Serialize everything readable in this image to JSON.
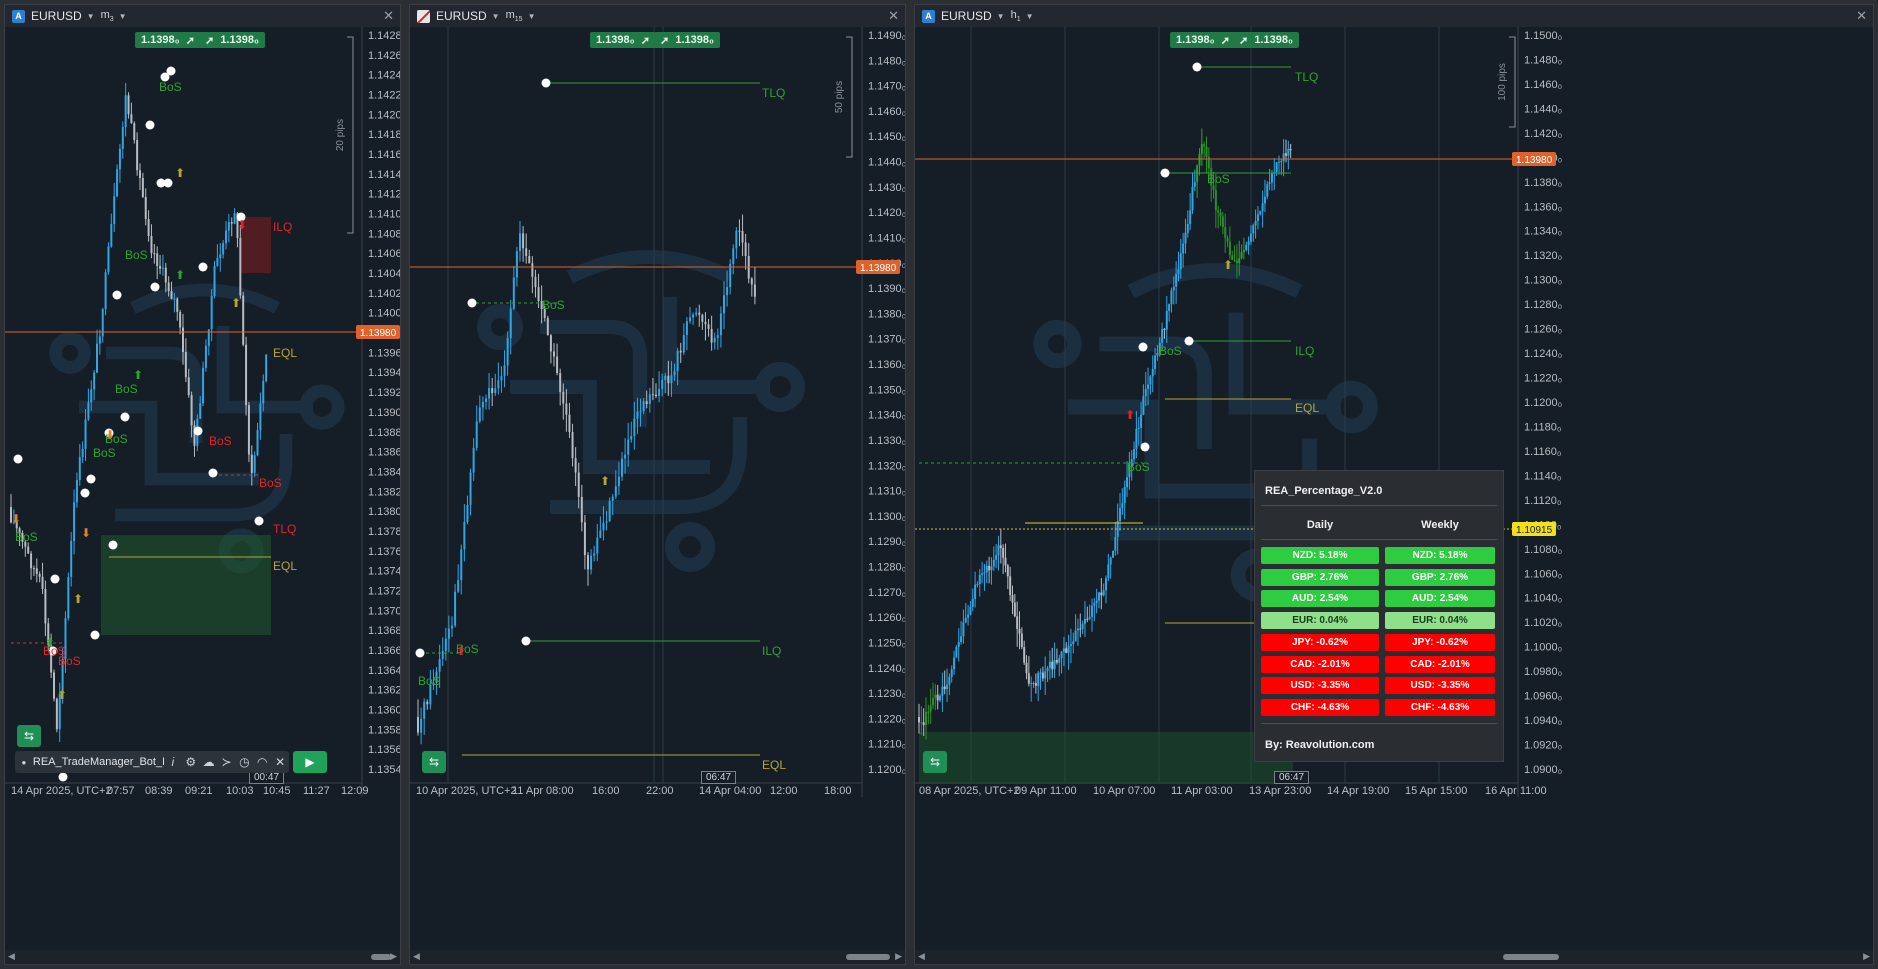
{
  "panes": [
    {
      "symbol": "EURUSD",
      "timeframe_main": "m",
      "timeframe_sub": "3",
      "bid_tag": "1.1398₀",
      "ask_tag": "1.1398₀",
      "y_labels": [
        "1.1428₀",
        "1.1426₀",
        "1.1424₀",
        "1.1422₀",
        "1.1420₀",
        "1.1418₀",
        "1.1416₀",
        "1.1414₀",
        "1.1412₀",
        "1.1410₀",
        "1.1408₀",
        "1.1406₀",
        "1.1404₀",
        "1.1402₀",
        "1.1400₀",
        "1.1398₀",
        "1.1396₀",
        "1.1394₀",
        "1.1392₀",
        "1.1390₀",
        "1.1388₀",
        "1.1386₀",
        "1.1384₀",
        "1.1382₀",
        "1.1380₀",
        "1.1378₀",
        "1.1376₀",
        "1.1374₀",
        "1.1372₀",
        "1.1370₀",
        "1.1368₀",
        "1.1366₀",
        "1.1364₀",
        "1.1362₀",
        "1.1360₀",
        "1.1358₀",
        "1.1356₀",
        "1.1354₀"
      ],
      "x_labels": [
        "14 Apr 2025, UTC+2",
        "07:57",
        "08:39",
        "09:21",
        "10:03",
        "10:45",
        "11:27",
        "12:09"
      ],
      "current_price": "1.13980",
      "pips_label": "20 pips",
      "time_box": "00:47",
      "annotations": [
        "BoS",
        "BoS",
        "BoS",
        "BoS",
        "BoS",
        "BoS",
        "BoS",
        "BoS",
        "BoS",
        "ILQ",
        "EQL",
        "TLQ",
        "EQL",
        "BoS"
      ],
      "bot_name": "REA_TradeManager_Bot_Lice..."
    },
    {
      "symbol": "EURUSD",
      "timeframe_main": "m",
      "timeframe_sub": "15",
      "bid_tag": "1.1398₀",
      "ask_tag": "1.1398₀",
      "y_labels": [
        "1.1490₀",
        "1.1480₀",
        "1.1470₀",
        "1.1460₀",
        "1.1450₀",
        "1.1440₀",
        "1.1430₀",
        "1.1420₀",
        "1.1410₀",
        "1.1400₀",
        "1.1390₀",
        "1.1380₀",
        "1.1370₀",
        "1.1360₀",
        "1.1350₀",
        "1.1340₀",
        "1.1330₀",
        "1.1320₀",
        "1.1310₀",
        "1.1300₀",
        "1.1290₀",
        "1.1280₀",
        "1.1270₀",
        "1.1260₀",
        "1.1250₀",
        "1.1240₀",
        "1.1230₀",
        "1.1220₀",
        "1.1210₀",
        "1.1200₀"
      ],
      "x_labels": [
        "10 Apr 2025, UTC+2",
        "11 Apr 08:00",
        "16:00",
        "22:00",
        "14 Apr 04:00",
        "12:00",
        "18:00"
      ],
      "current_price": "1.13980",
      "pips_label": "50 pips",
      "time_box": "06:47",
      "annotations": [
        "TLQ",
        "BoS",
        "BoS",
        "BoS",
        "ILQ",
        "EQL"
      ]
    },
    {
      "symbol": "EURUSD",
      "timeframe_main": "h",
      "timeframe_sub": "1",
      "bid_tag": "1.1398₀",
      "ask_tag": "1.1398₀",
      "y_labels": [
        "1.1500₀",
        "1.1480₀",
        "1.1460₀",
        "1.1440₀",
        "1.1420₀",
        "1.1400₀",
        "1.1380₀",
        "1.1360₀",
        "1.1340₀",
        "1.1320₀",
        "1.1300₀",
        "1.1280₀",
        "1.1260₀",
        "1.1240₀",
        "1.1220₀",
        "1.1200₀",
        "1.1180₀",
        "1.1160₀",
        "1.1140₀",
        "1.1120₀",
        "1.1100₀",
        "1.1080₀",
        "1.1060₀",
        "1.1040₀",
        "1.1020₀",
        "1.1000₀",
        "1.0980₀",
        "1.0960₀",
        "1.0940₀",
        "1.0920₀",
        "1.0900₀"
      ],
      "x_labels": [
        "08 Apr 2025, UTC+2",
        "09 Apr 11:00",
        "10 Apr 07:00",
        "11 Apr 03:00",
        "13 Apr 23:00",
        "14 Apr 19:00",
        "15 Apr 15:00",
        "16 Apr 11:00"
      ],
      "current_price": "1.13980",
      "yellow_price": "1.10915",
      "pips_label": "100 pips",
      "time_box": "06:47",
      "annotations": [
        "TLQ",
        "BoS",
        "BoS",
        "ILQ",
        "EQL",
        "BoS"
      ]
    }
  ],
  "percentage_panel": {
    "title": "REA_Percentage_V2.0",
    "col_daily": "Daily",
    "col_weekly": "Weekly",
    "rows": [
      {
        "text": "NZD: 5.18%",
        "color": "#2ecc40"
      },
      {
        "text": "GBP: 2.76%",
        "color": "#2ecc40"
      },
      {
        "text": "AUD: 2.54%",
        "color": "#2ecc40"
      },
      {
        "text": "EUR: 0.04%",
        "color": "#8ee08a"
      },
      {
        "text": "JPY: -0.62%",
        "color": "#ff0000"
      },
      {
        "text": "CAD: -2.01%",
        "color": "#ff0000"
      },
      {
        "text": "USD: -3.35%",
        "color": "#ff0000"
      },
      {
        "text": "CHF: -4.63%",
        "color": "#ff0000"
      }
    ],
    "footer": "By: Reavolution.com"
  },
  "colors": {
    "bull": "#2fa6e6",
    "bear": "#b8bcc2",
    "price_line": "#e0622b",
    "bos_green": "#2fa32f",
    "bos_red": "#e0262a",
    "eql": "#b6a536"
  }
}
